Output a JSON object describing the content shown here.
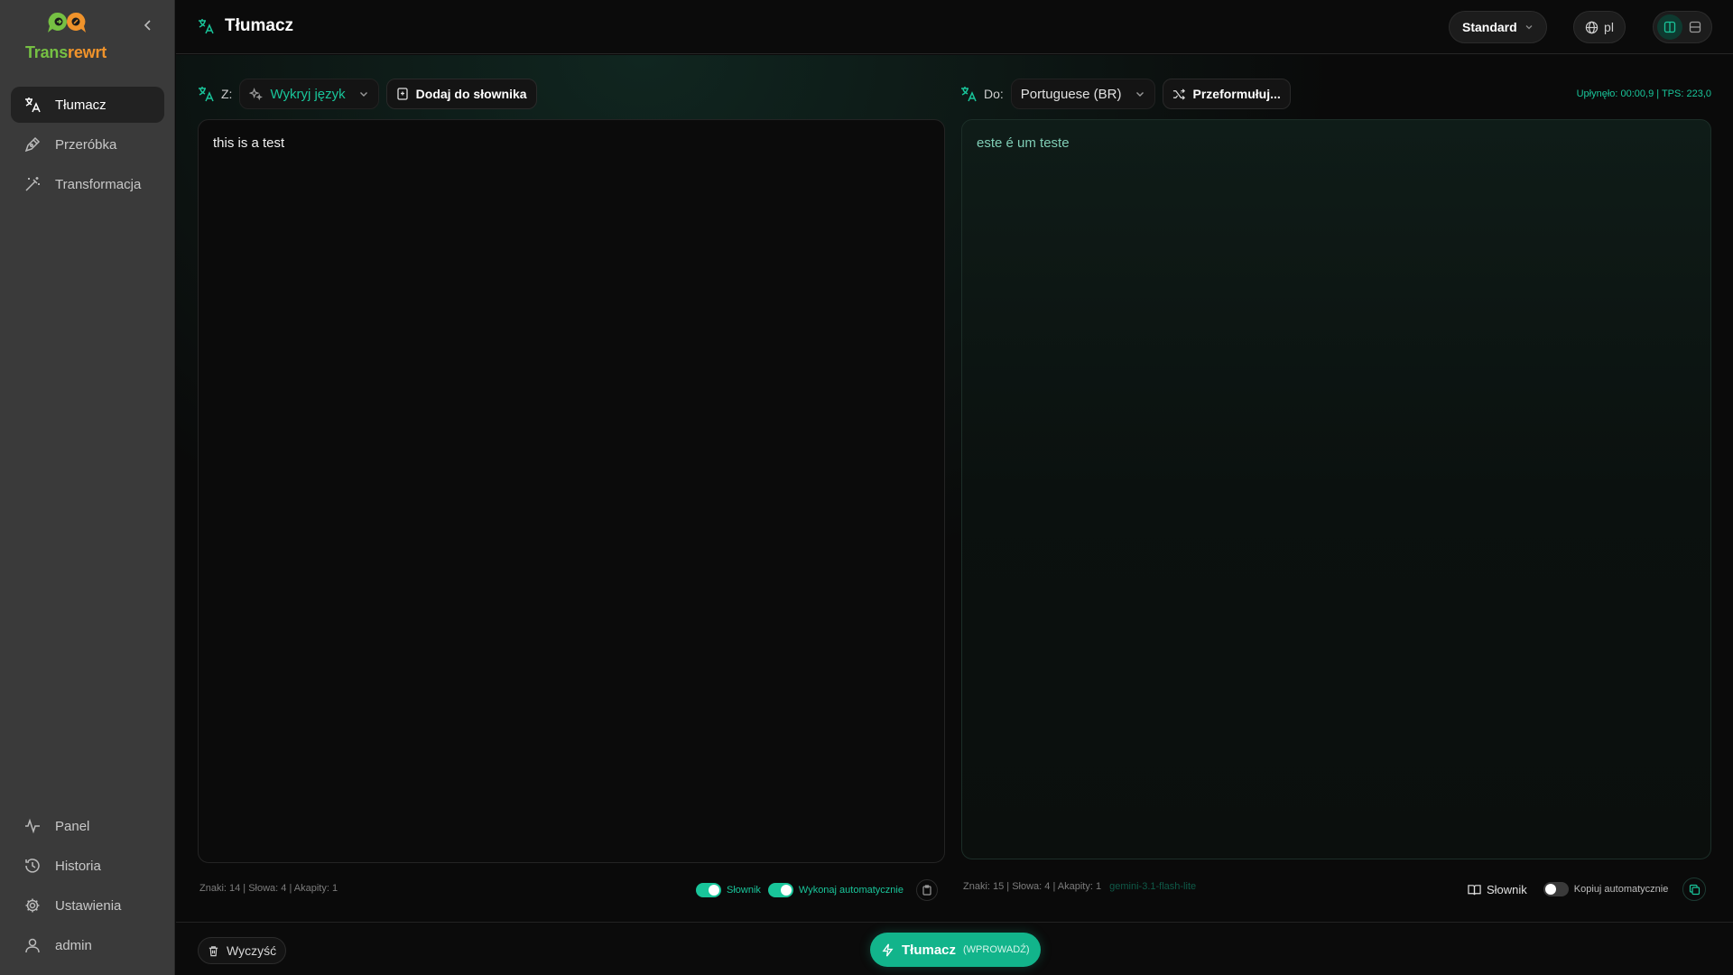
{
  "brand": {
    "name_part1": "Trans",
    "name_part2": "rewrt"
  },
  "sidebar": {
    "nav": [
      {
        "label": "Tłumacz",
        "icon": "translate-icon",
        "active": true
      },
      {
        "label": "Przeróbka",
        "icon": "pen-icon",
        "active": false
      },
      {
        "label": "Transformacja",
        "icon": "magic-wand-icon",
        "active": false
      }
    ],
    "bottom": [
      {
        "label": "Panel",
        "icon": "activity-icon"
      },
      {
        "label": "Historia",
        "icon": "history-icon"
      },
      {
        "label": "Ustawienia",
        "icon": "gear-icon"
      },
      {
        "label": "admin",
        "icon": "user-icon"
      }
    ]
  },
  "header": {
    "title": "Tłumacz",
    "mode": "Standard",
    "ui_language": "pl"
  },
  "source": {
    "from_label": "Z:",
    "language": "Wykryj język",
    "add_dict_label": "Dodaj do słownika",
    "text": "this is a test",
    "stats": "Znaki: 14 | Słowa: 4 | Akapity: 1",
    "toggle_dictionary": "Słownik",
    "toggle_auto": "Wykonaj automatycznie"
  },
  "target": {
    "to_label": "Do:",
    "language": "Portuguese (BR)",
    "rephrase_label": "Przeformułuj...",
    "timing": "Upłynęło: 00:00,9 | TPS: 223,0",
    "text": "este é um teste",
    "stats": "Znaki: 15 | Słowa: 4 | Akapity: 1",
    "model": "gemini-3.1-flash-lite",
    "dictionary_label": "Słownik",
    "auto_copy_label": "Kopiuj automatycznie"
  },
  "bottom_bar": {
    "clear_label": "Wyczyść",
    "translate_label": "Tłumacz",
    "translate_shortcut": "(WPROWADŹ)"
  },
  "colors": {
    "accent": "#19c59a",
    "brand_green": "#76c043",
    "brand_orange": "#f0932b"
  }
}
